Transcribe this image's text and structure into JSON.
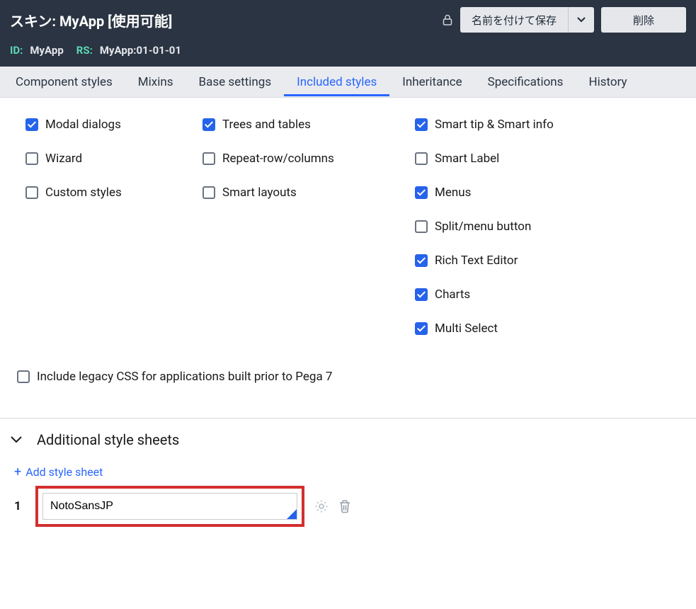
{
  "header": {
    "title": "スキン: MyApp [使用可能]",
    "save_as_label": "名前を付けて保存",
    "delete_label": "削除",
    "meta": {
      "id_label": "ID:",
      "id_value": "MyApp",
      "rs_label": "RS:",
      "rs_value": "MyApp:01-01-01"
    }
  },
  "tabs": [
    {
      "label": "Component styles"
    },
    {
      "label": "Mixins"
    },
    {
      "label": "Base settings"
    },
    {
      "label": "Included styles"
    },
    {
      "label": "Inheritance"
    },
    {
      "label": "Specifications"
    },
    {
      "label": "History"
    }
  ],
  "active_tab_index": 3,
  "checkboxes": {
    "col1": [
      {
        "label": "Modal dialogs",
        "checked": true
      },
      {
        "label": "Wizard",
        "checked": false
      },
      {
        "label": "Custom styles",
        "checked": false
      }
    ],
    "col2": [
      {
        "label": "Trees and tables",
        "checked": true
      },
      {
        "label": "Repeat-row/columns",
        "checked": false
      },
      {
        "label": "Smart layouts",
        "checked": false
      }
    ],
    "col3": [
      {
        "label": "Smart tip & Smart info",
        "checked": true
      },
      {
        "label": "Smart Label",
        "checked": false
      },
      {
        "label": "Menus",
        "checked": true
      },
      {
        "label": "Split/menu button",
        "checked": false
      },
      {
        "label": "Rich Text Editor",
        "checked": true
      },
      {
        "label": "Charts",
        "checked": true
      },
      {
        "label": "Multi Select",
        "checked": true
      }
    ]
  },
  "legacy_css": {
    "label": "Include legacy CSS for applications built prior to Pega 7",
    "checked": false
  },
  "additional_styles": {
    "title": "Additional style sheets",
    "add_label": "Add style sheet",
    "rows": [
      {
        "index": "1",
        "value": "NotoSansJP"
      }
    ]
  }
}
